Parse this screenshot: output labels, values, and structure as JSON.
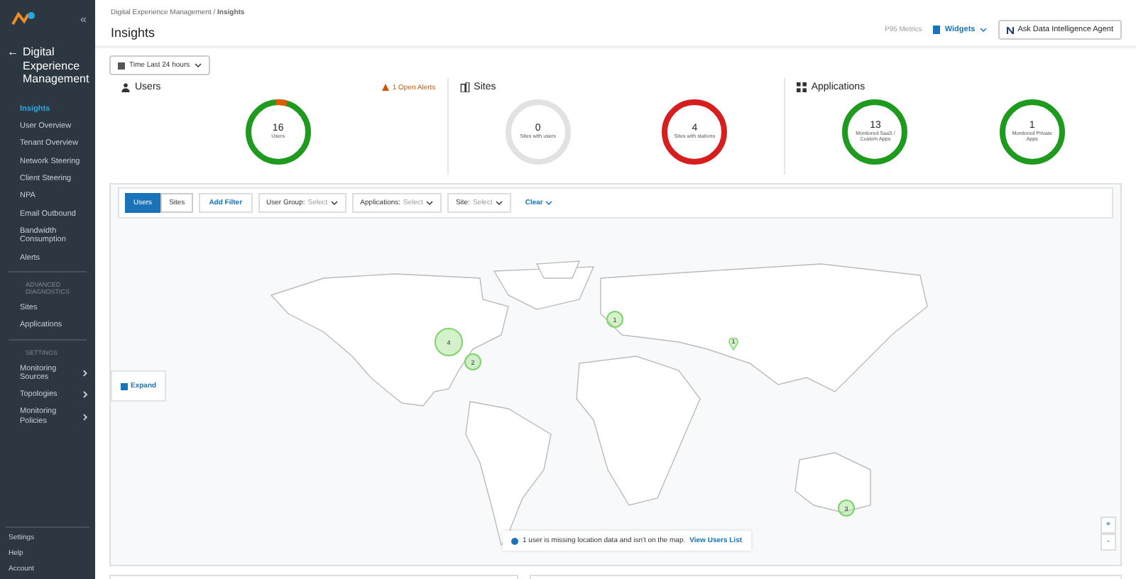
{
  "sidebar": {
    "collapse": "«",
    "section": {
      "back": "←",
      "title": "Digital Experience Management"
    },
    "items": [
      {
        "label": "Insights",
        "selected": true
      },
      {
        "label": "User Overview",
        "selected": false
      },
      {
        "label": "Tenant Overview",
        "selected": false
      },
      {
        "label": "Network Steering",
        "selected": false
      },
      {
        "label": "Client Steering",
        "selected": false
      },
      {
        "label": "NPA",
        "selected": false
      },
      {
        "label": "Email Outbound",
        "selected": false
      },
      {
        "label": "Bandwidth Consumption",
        "selected": false
      },
      {
        "label": "Alerts",
        "selected": false
      }
    ],
    "groups": [
      {
        "heading": "ADVANCED DIAGNOSTICS",
        "items": [
          {
            "label": "Sites",
            "expandable": false
          },
          {
            "label": "Applications",
            "expandable": false
          }
        ]
      },
      {
        "heading": "SETTINGS",
        "items": [
          {
            "label": "Monitoring Sources",
            "expandable": true
          },
          {
            "label": "Topologies",
            "expandable": true
          },
          {
            "label": "Monitoring Policies",
            "expandable": true
          }
        ]
      }
    ],
    "footer": [
      "Settings",
      "Help",
      "Account"
    ]
  },
  "header": {
    "breadcrumb": "Digital Experience Management / ",
    "breadcrumb_current": "Insights",
    "title": "Insights",
    "pps": "P95 Metrics",
    "widgets": "Widgets",
    "agent": "Ask Data Intelligence Agent"
  },
  "time_filter": "Time Last 24 hours",
  "cards": [
    {
      "title": "Users",
      "alert": "1 Open Alerts",
      "donuts": [
        {
          "value": "16",
          "label": "Users",
          "color": "#1e9a1e",
          "level": 0.06
        }
      ]
    },
    {
      "title": "Sites",
      "donuts": [
        {
          "value": "0",
          "label": "Sites with users",
          "color": "#e2e2e2"
        },
        {
          "value": "4",
          "label": "Sites with stations",
          "color": "#d71e1e"
        }
      ]
    },
    {
      "title": "Applications",
      "donuts": [
        {
          "value": "13",
          "label": "Monitored SaaS / Custom Apps",
          "color": "#1e9a1e"
        },
        {
          "value": "1",
          "label": "Monitored Private Apps",
          "color": "#1e9a1e"
        }
      ]
    }
  ],
  "map": {
    "view_tabs": [
      {
        "label": "Users",
        "selected": true
      },
      {
        "label": "Sites",
        "selected": false
      }
    ],
    "add_filter": "Add Filter",
    "filters": [
      {
        "name": "User Group:",
        "value": "Select"
      },
      {
        "name": "Applications:",
        "value": "Select"
      },
      {
        "name": "Site:",
        "value": "Select"
      }
    ],
    "clear": "Clear",
    "expand": "Expand",
    "markers": [
      {
        "count": "4",
        "kind": "cluster"
      },
      {
        "count": "2",
        "kind": "cluster"
      },
      {
        "count": "1",
        "kind": "cluster"
      },
      {
        "count": "1",
        "kind": "pin"
      },
      {
        "count": "3",
        "kind": "cluster"
      }
    ],
    "notice": "1 user is missing location data and isn't on the map.",
    "notice_link": "View Users List",
    "zoom": [
      "+",
      "-"
    ]
  }
}
